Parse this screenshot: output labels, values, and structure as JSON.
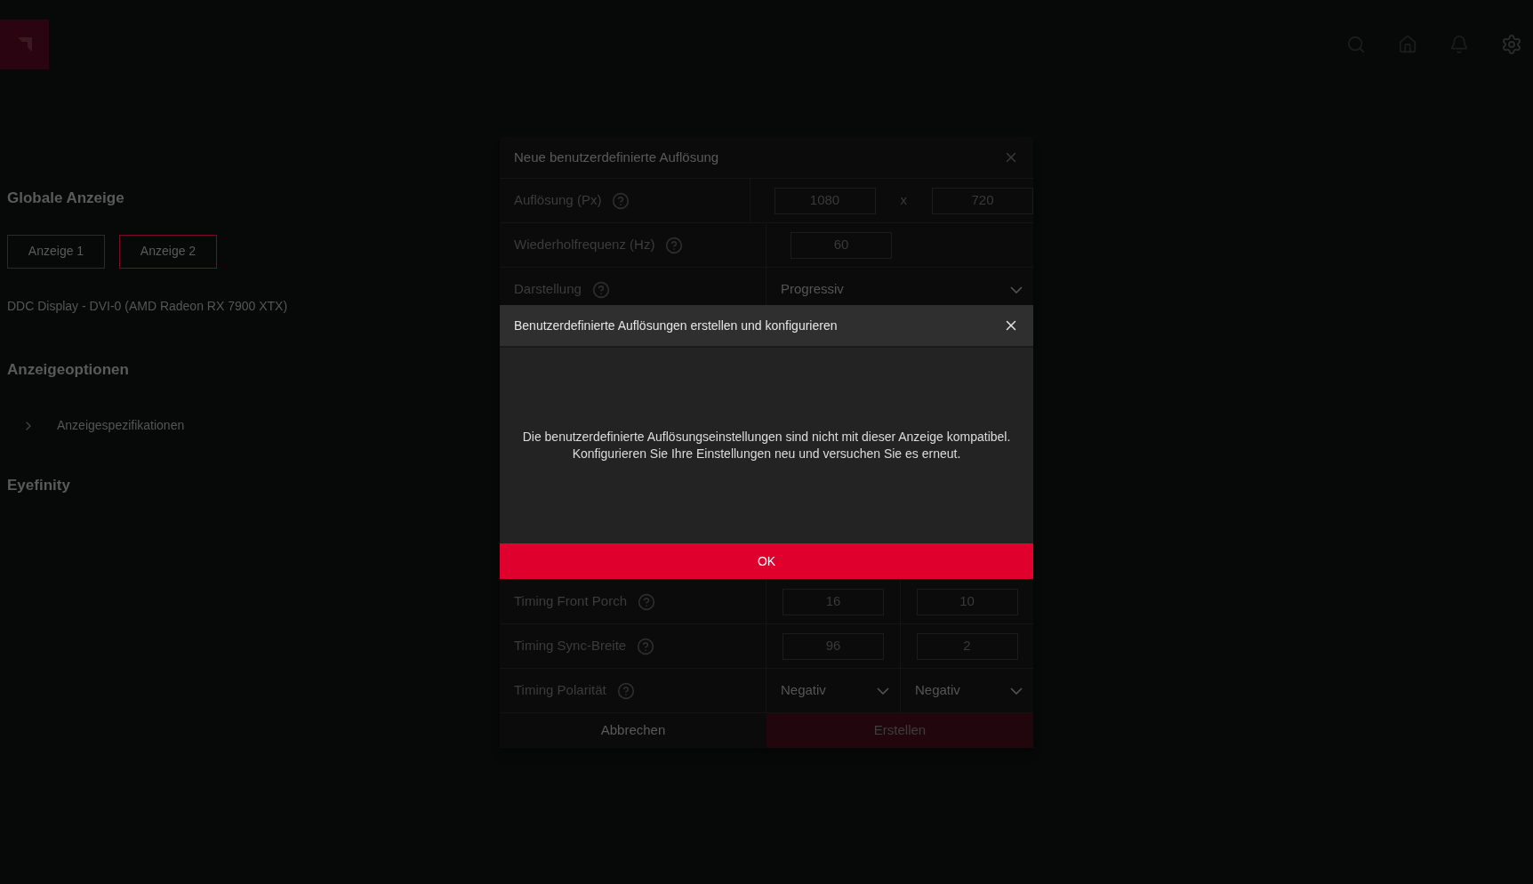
{
  "page": {
    "heading_1": "Globale Anzeige",
    "display_tabs": [
      {
        "label": "Anzeige 1",
        "selected": false
      },
      {
        "label": "Anzeige 2",
        "selected": true
      }
    ],
    "display_name": "DDC Display - DVI-0 (AMD Radeon RX 7900 XTX)",
    "heading_2": "Anzeigeoptionen",
    "expander": "Anzeigespezifikationen",
    "heading_3": "Eyefinity"
  },
  "resolution_dialog": {
    "title": "Neue benutzerdefinierte Auflösung",
    "upper_rows": [
      {
        "kind": "pair",
        "label": "Auflösung (Px)",
        "values": [
          "1080",
          "720"
        ],
        "separator": "x"
      },
      {
        "kind": "single",
        "label": "Wiederholfrequenz (Hz)",
        "values": [
          "60"
        ]
      },
      {
        "kind": "select",
        "label": "Darstellung",
        "values": [
          "Progressiv"
        ]
      }
    ],
    "lower_rows": [
      {
        "kind": "fields",
        "label": "Timing Front Porch",
        "values": [
          "16",
          "10"
        ]
      },
      {
        "kind": "fields",
        "label": "Timing Sync-Breite",
        "values": [
          "96",
          "2"
        ]
      },
      {
        "kind": "selects",
        "label": "Timing Polarität",
        "values": [
          "Negativ",
          "Negativ"
        ]
      }
    ],
    "cancel": "Abbrechen",
    "create": "Erstellen"
  },
  "alert": {
    "title": "Benutzerdefinierte Auflösungen erstellen und konfigurieren",
    "message": [
      "Die benutzerdefinierte Auflösungseinstellungen sind nicht mit dieser Anzeige kompatibel.",
      "Konfigurieren Sie Ihre Einstellungen neu und versuchen Sie es erneut."
    ],
    "ok": "OK"
  }
}
